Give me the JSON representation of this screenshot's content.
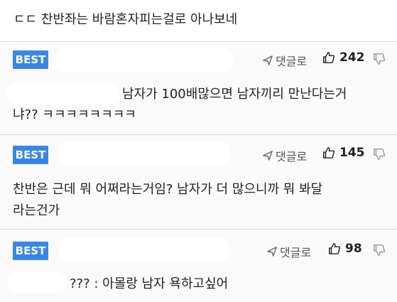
{
  "top_comment": {
    "text": "ㄷㄷ 찬반좌는 바람혼자피는걸로 아나보네"
  },
  "comments": [
    {
      "badge": "BEST",
      "reply_label": "댓글로",
      "likes": "242",
      "line1": "남자가 100배많으면 남자끼리 만난다는거",
      "line2": "냐?? ㅋㅋㅋㅋㅋㅋㅋㅋ"
    },
    {
      "badge": "BEST",
      "reply_label": "댓글로",
      "likes": "145",
      "line1": "찬반은 근데 뭐 어쩌라는거임? 남자가 더 많으니까 뭐 봐달",
      "line2": "라는건가"
    },
    {
      "badge": "BEST",
      "reply_label": "댓글로",
      "likes": "98",
      "line1": "??? : 아몰랑 남자 욕하고싶어"
    }
  ],
  "icons": {
    "reply": "send-arrow-icon",
    "like": "thumbs-up-icon",
    "dislike": "thumbs-down-icon"
  },
  "colors": {
    "best_badge": "#3a86e6",
    "background": "#f3f3f3"
  }
}
